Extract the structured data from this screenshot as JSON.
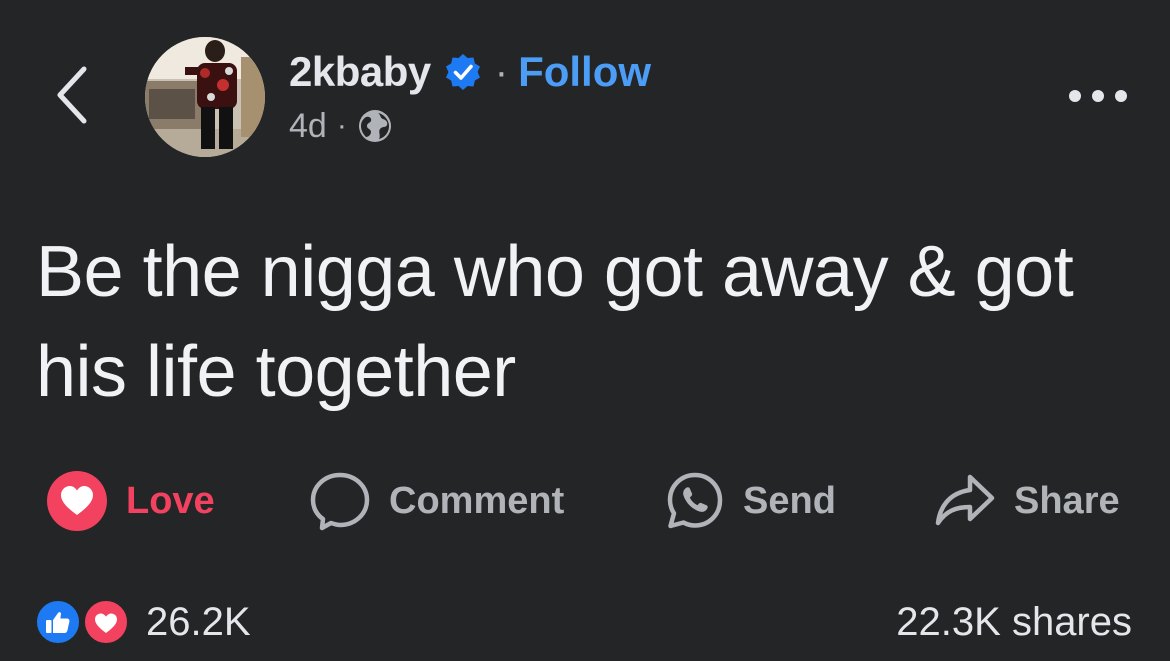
{
  "header": {
    "author_name": "2kbaby",
    "separator": "·",
    "follow_label": "Follow",
    "timestamp": "4d",
    "meta_separator": "·",
    "back_icon": "chevron-left-icon",
    "verified_icon": "verified-badge-icon",
    "privacy_icon": "globe-icon",
    "more_icon": "more-horizontal-icon"
  },
  "post": {
    "text": "Be the nigga who got away & got his life together"
  },
  "actions": {
    "love_label": "Love",
    "comment_label": "Comment",
    "send_label": "Send",
    "share_label": "Share"
  },
  "footer": {
    "reaction_count": "26.2K",
    "shares_text": "22.3K shares"
  },
  "colors": {
    "background": "#242527",
    "primary_text": "#e4e6eb",
    "secondary_text": "#b0b3b8",
    "link_blue": "#4c9df5",
    "love_red": "#f3425f",
    "like_blue": "#1d7af2"
  }
}
